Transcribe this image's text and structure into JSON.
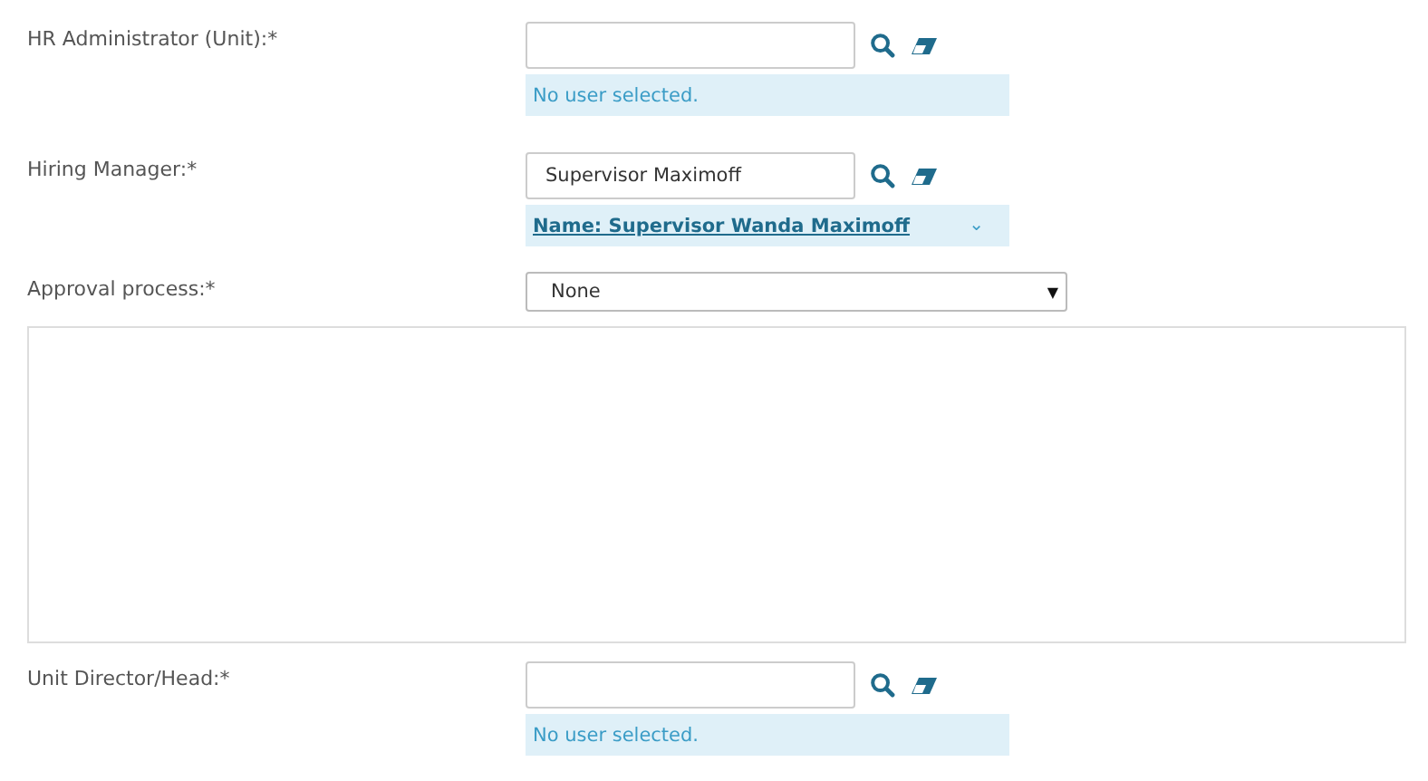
{
  "fields": [
    {
      "kind": "user",
      "label": "HR Administrator (Unit):*",
      "result": "No user selected.",
      "linked": false
    },
    {
      "kind": "user",
      "label": "Hiring Manager:*",
      "value": "Supervisor Maximoff",
      "result": "Name: Supervisor Wanda Maximoff",
      "linked": true,
      "caret": "⌄"
    },
    {
      "kind": "select",
      "label": "Approval process:*",
      "value": "None",
      "arrow": "▼"
    },
    {
      "kind": "textarea"
    },
    {
      "kind": "user",
      "label": "Unit Director/Head:*",
      "result": "No user selected.",
      "linked": false
    }
  ]
}
